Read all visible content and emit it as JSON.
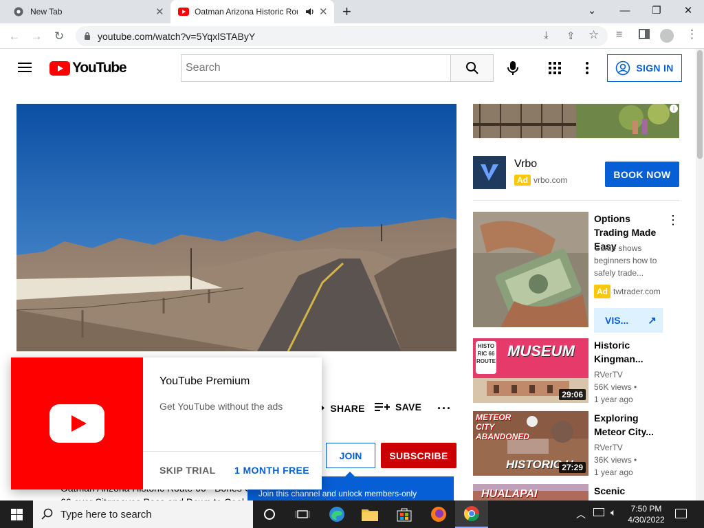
{
  "browser": {
    "tabs": [
      {
        "title": "New Tab"
      },
      {
        "title": "Oatman Arizona Historic Rou"
      }
    ],
    "url": "youtube.com/watch?v=5YqxlSTAByY"
  },
  "header": {
    "logo_text": "YouTube",
    "search_placeholder": "Search",
    "sign_in": "SIGN IN"
  },
  "actions": {
    "share": "SHARE",
    "save": "SAVE",
    "join": "JOIN",
    "subscribe": "SUBSCRIBE"
  },
  "premium_popup": {
    "title": "YouTube Premium",
    "subtitle": "Get YouTube without the ads",
    "skip": "SKIP TRIAL",
    "free": "1 MONTH FREE"
  },
  "members_banner": "Join this channel and unlock members-only",
  "description_fragments": [
    "Oatman Arizona Historic Route 66 - Bones C",
    "66 over Sitgreaves Pass and Down to Cool S"
  ],
  "sidebar": {
    "top_ad": {
      "advertiser": "Vrbo",
      "ad_label": "Ad",
      "domain": "vrbo.com",
      "cta": "BOOK NOW"
    },
    "promo_ad": {
      "title": "Options Trading Made Easy",
      "description": "Guide shows beginners how to safely trade...",
      "ad_label": "Ad",
      "domain": "twtrader.com",
      "cta": "VIS..."
    },
    "videos": [
      {
        "title": "Historic Kingman...",
        "channel": "RVerTV",
        "views": "56K views",
        "age": "1 year ago",
        "duration": "29:06",
        "thumb_text": "MUSEUM",
        "thumb_badge": "HISTORIC 66 ROUTE"
      },
      {
        "title": "Exploring Meteor City...",
        "channel": "RVerTV",
        "views": "36K views",
        "age": "1 year ago",
        "duration": "27:29",
        "thumb_text": "METEOR CITY ABANDONED",
        "thumb_badge": "HISTORIC U"
      },
      {
        "title": "Scenic",
        "thumb_text": "HUALAPAI"
      }
    ]
  },
  "taskbar": {
    "search_placeholder": "Type here to search",
    "time": "7:50 PM",
    "date": "4/30/2022"
  },
  "colors": {
    "yt_red": "#ff0000",
    "link_blue": "#065fd4",
    "subscribe_red": "#cc0000",
    "ad_yellow": "#f9c80e",
    "taskbar": "#1f1f1f"
  }
}
